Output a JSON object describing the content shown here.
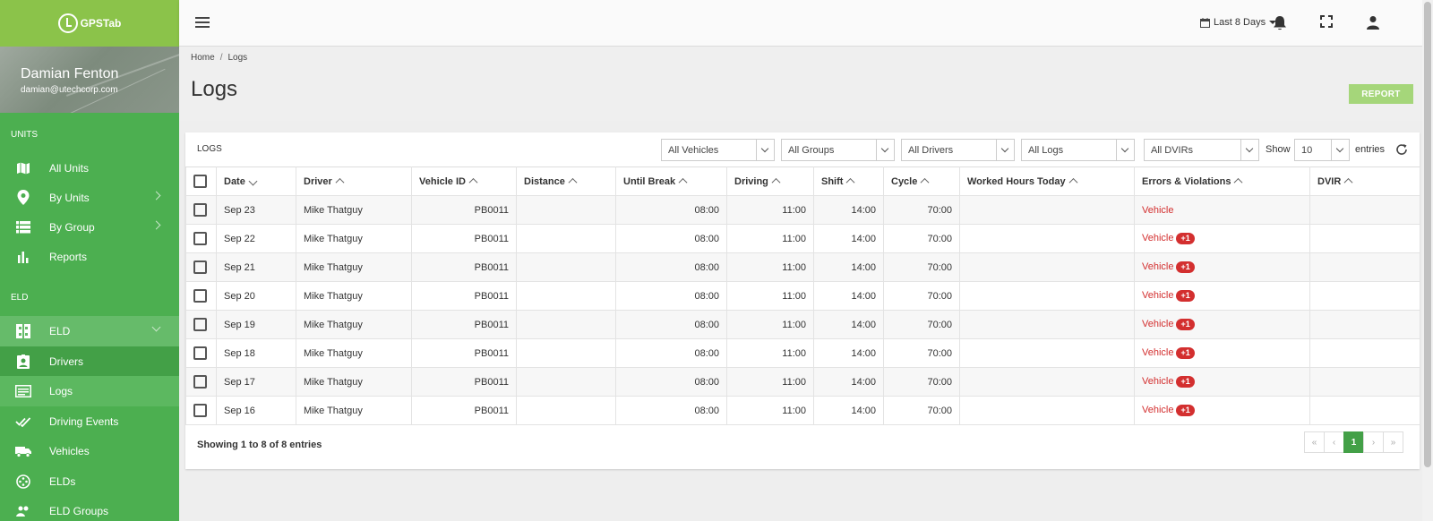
{
  "brand": {
    "name": "GPSTab"
  },
  "user": {
    "name": "Damian Fenton",
    "email": "damian@utechcorp.com"
  },
  "sidebar": {
    "sections": [
      "UNITS",
      "ELD"
    ],
    "units_items": [
      {
        "label": "All Units",
        "icon": "map-icon"
      },
      {
        "label": "By Units",
        "icon": "location-pin-icon"
      },
      {
        "label": "By Group",
        "icon": "list-icon"
      },
      {
        "label": "Reports",
        "icon": "bar-chart-icon"
      }
    ],
    "eld_items": [
      {
        "label": "ELD",
        "icon": "eld-device-icon"
      },
      {
        "label": "Drivers",
        "icon": "id-badge-icon"
      },
      {
        "label": "Logs",
        "icon": "logs-icon"
      },
      {
        "label": "Driving Events",
        "icon": "double-check-icon"
      },
      {
        "label": "Vehicles",
        "icon": "truck-icon"
      },
      {
        "label": "ELDs",
        "icon": "dial-icon"
      },
      {
        "label": "ELD Groups",
        "icon": "group-icon"
      }
    ]
  },
  "topbar": {
    "date_filter": "Last 8 Days"
  },
  "breadcrumb": [
    "Home",
    "Logs"
  ],
  "page": {
    "title": "Logs",
    "report_button": "REPORT"
  },
  "card": {
    "title": "LOGS",
    "filters": [
      "All Vehicles",
      "All Groups",
      "All Drivers",
      "All Logs",
      "All DVIRs"
    ],
    "show_label": "Show",
    "page_size": "10",
    "entries_label": "entries"
  },
  "table": {
    "columns": [
      "Date",
      "Driver",
      "Vehicle ID",
      "Distance",
      "Until Break",
      "Driving",
      "Shift",
      "Cycle",
      "Worked Hours Today",
      "Errors & Violations",
      "DVIR"
    ],
    "rows": [
      {
        "date": "Sep 23",
        "driver": "Mike Thatguy",
        "vehicle": "PB0011",
        "distance": "",
        "until_break": "08:00",
        "driving": "11:00",
        "shift": "14:00",
        "cycle": "70:00",
        "worked": "",
        "error": "Vehicle",
        "badge": "",
        "dvir": ""
      },
      {
        "date": "Sep 22",
        "driver": "Mike Thatguy",
        "vehicle": "PB0011",
        "distance": "",
        "until_break": "08:00",
        "driving": "11:00",
        "shift": "14:00",
        "cycle": "70:00",
        "worked": "",
        "error": "Vehicle",
        "badge": "+1",
        "dvir": ""
      },
      {
        "date": "Sep 21",
        "driver": "Mike Thatguy",
        "vehicle": "PB0011",
        "distance": "",
        "until_break": "08:00",
        "driving": "11:00",
        "shift": "14:00",
        "cycle": "70:00",
        "worked": "",
        "error": "Vehicle",
        "badge": "+1",
        "dvir": ""
      },
      {
        "date": "Sep 20",
        "driver": "Mike Thatguy",
        "vehicle": "PB0011",
        "distance": "",
        "until_break": "08:00",
        "driving": "11:00",
        "shift": "14:00",
        "cycle": "70:00",
        "worked": "",
        "error": "Vehicle",
        "badge": "+1",
        "dvir": ""
      },
      {
        "date": "Sep 19",
        "driver": "Mike Thatguy",
        "vehicle": "PB0011",
        "distance": "",
        "until_break": "08:00",
        "driving": "11:00",
        "shift": "14:00",
        "cycle": "70:00",
        "worked": "",
        "error": "Vehicle",
        "badge": "+1",
        "dvir": ""
      },
      {
        "date": "Sep 18",
        "driver": "Mike Thatguy",
        "vehicle": "PB0011",
        "distance": "",
        "until_break": "08:00",
        "driving": "11:00",
        "shift": "14:00",
        "cycle": "70:00",
        "worked": "",
        "error": "Vehicle",
        "badge": "+1",
        "dvir": ""
      },
      {
        "date": "Sep 17",
        "driver": "Mike Thatguy",
        "vehicle": "PB0011",
        "distance": "",
        "until_break": "08:00",
        "driving": "11:00",
        "shift": "14:00",
        "cycle": "70:00",
        "worked": "",
        "error": "Vehicle",
        "badge": "+1",
        "dvir": ""
      },
      {
        "date": "Sep 16",
        "driver": "Mike Thatguy",
        "vehicle": "PB0011",
        "distance": "",
        "until_break": "08:00",
        "driving": "11:00",
        "shift": "14:00",
        "cycle": "70:00",
        "worked": "",
        "error": "Vehicle",
        "badge": "+1",
        "dvir": ""
      }
    ]
  },
  "footer": {
    "info": "Showing 1 to 8 of 8 entries",
    "current_page": "1",
    "pager_icons": [
      "first-page-icon",
      "prev-page-icon",
      "next-page-icon",
      "last-page-icon"
    ]
  },
  "colors": {
    "sidebar_green": "#4caf50",
    "logo_green": "#8bc34a",
    "active_page": "#43a047",
    "error_red": "#d32f2f",
    "report_button": "#a5d67a"
  }
}
